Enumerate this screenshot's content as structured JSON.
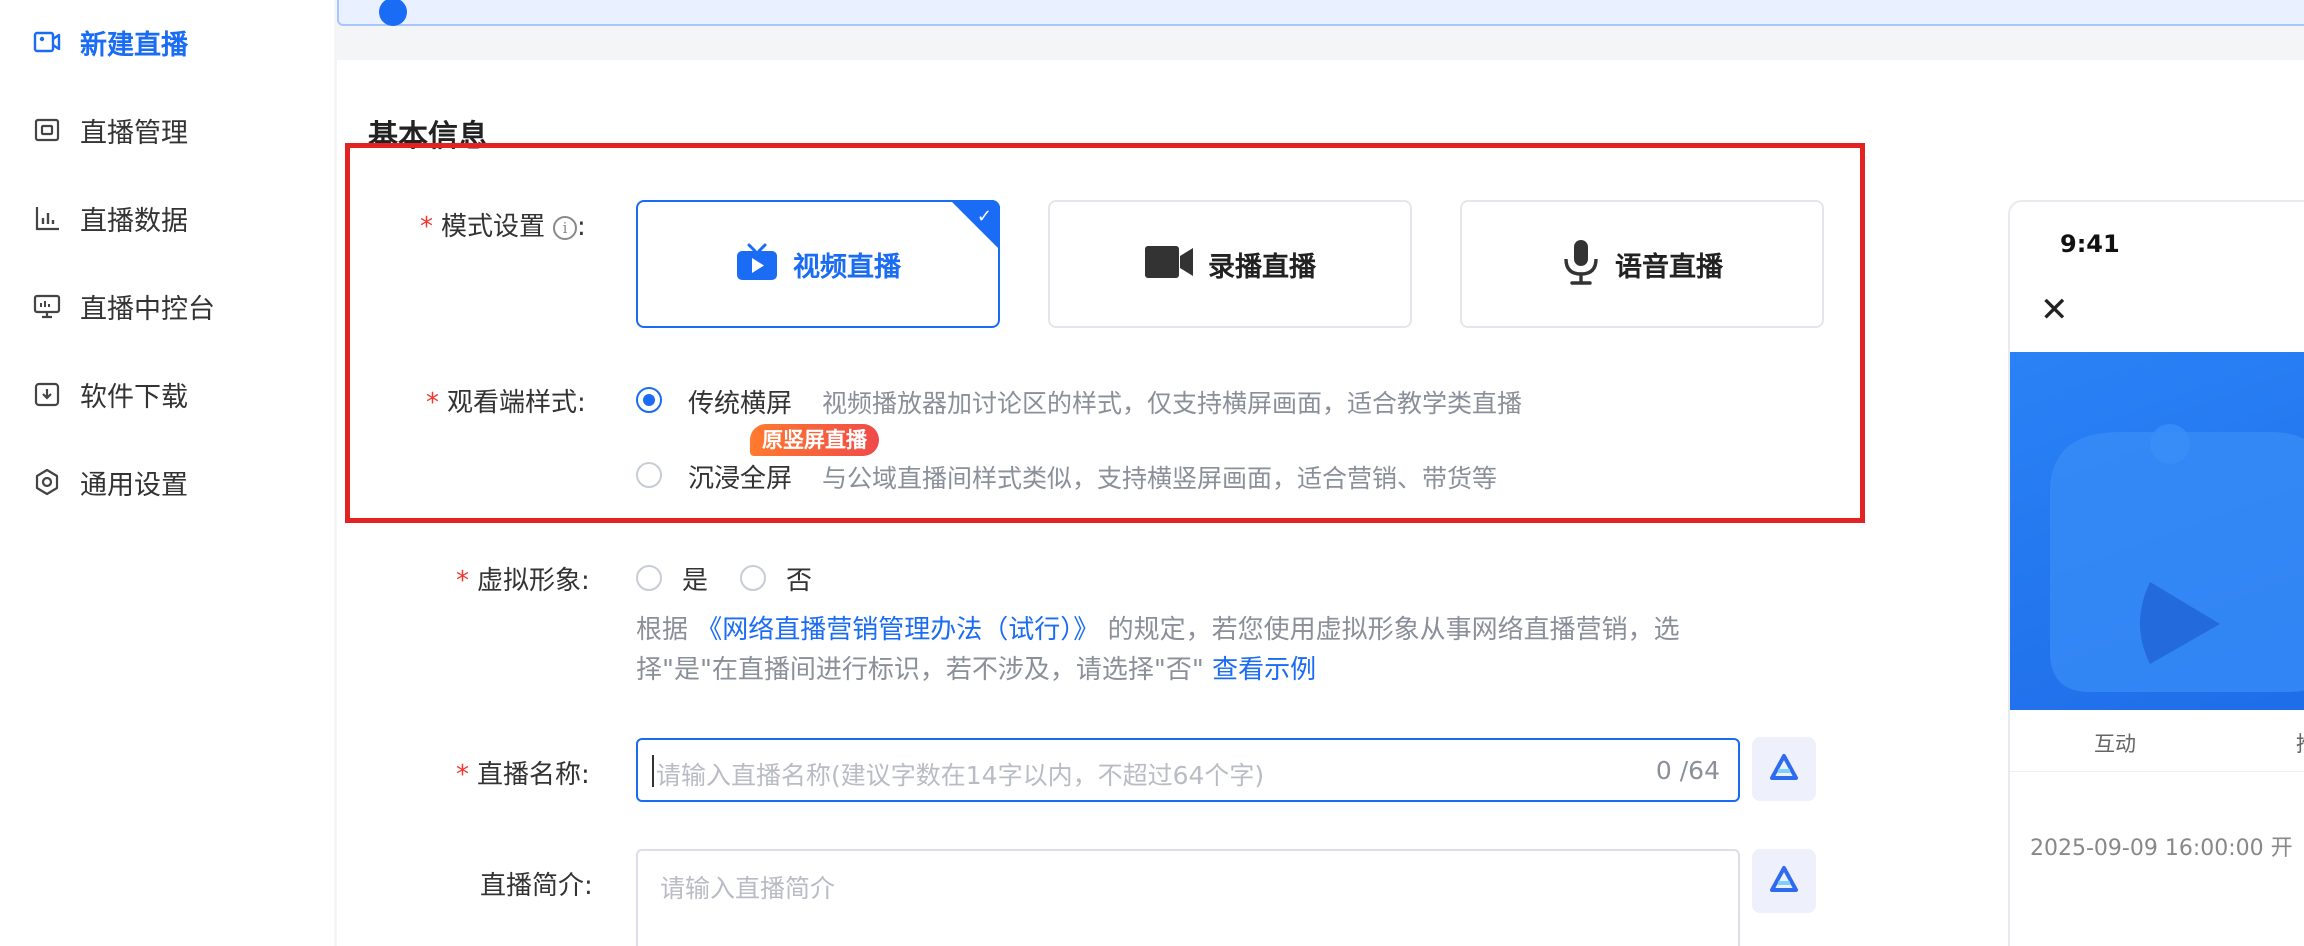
{
  "sidebar": {
    "items": [
      {
        "label": "新建直播",
        "icon": "new-live-icon",
        "active": true
      },
      {
        "label": "直播管理",
        "icon": "live-manage-icon"
      },
      {
        "label": "直播数据",
        "icon": "live-data-icon"
      },
      {
        "label": "直播中控台",
        "icon": "monitor-icon"
      },
      {
        "label": "软件下载",
        "icon": "download-icon"
      },
      {
        "label": "通用设置",
        "icon": "gear-icon"
      }
    ]
  },
  "section": {
    "title": "基本信息"
  },
  "mode_setting": {
    "label": "模式设置",
    "required": "*",
    "colon": ":",
    "options": [
      {
        "label": "视频直播",
        "icon": "tv-play-icon",
        "selected": true
      },
      {
        "label": "录播直播",
        "icon": "video-camera-icon"
      },
      {
        "label": "语音直播",
        "icon": "microphone-icon"
      }
    ],
    "check_mark": "✓"
  },
  "viewer_style": {
    "label": "观看端样式:",
    "required": "*",
    "options": [
      {
        "label": "传统横屏",
        "desc": "视频播放器加讨论区的样式，仅支持横屏画面，适合教学类直播",
        "checked": true
      },
      {
        "label": "沉浸全屏",
        "desc": "与公域直播间样式类似，支持横竖屏画面，适合营销、带货等",
        "badge": "原竖屏直播"
      }
    ]
  },
  "virtual_avatar": {
    "label": "虚拟形象:",
    "required": "*",
    "options": [
      "是",
      "否"
    ],
    "help_prefix": "根据",
    "help_link": "《网络直播营销管理办法（试行）》",
    "help_middle": "的规定，若您使用虚拟形象从事网络直播营销，选择\"是\"在直播间进行标识，若不涉及，请选择\"否\"",
    "help_example": "查看示例"
  },
  "live_name": {
    "label": "直播名称:",
    "required": "*",
    "placeholder": "请输入直播名称(建议字数在14字以内，不超过64个字)",
    "counter": "0 /64"
  },
  "live_intro": {
    "label": "直播简介:",
    "placeholder": "请输入直播简介"
  },
  "preview": {
    "status_time": "9:41",
    "close": "✕",
    "tab_1": "互动",
    "tab_2": "推",
    "start_time": "2025-09-09 16:00:00 开"
  },
  "colors": {
    "accent": "#1a6cf5",
    "highlight_border": "#e32222",
    "required": "#f5362b"
  }
}
